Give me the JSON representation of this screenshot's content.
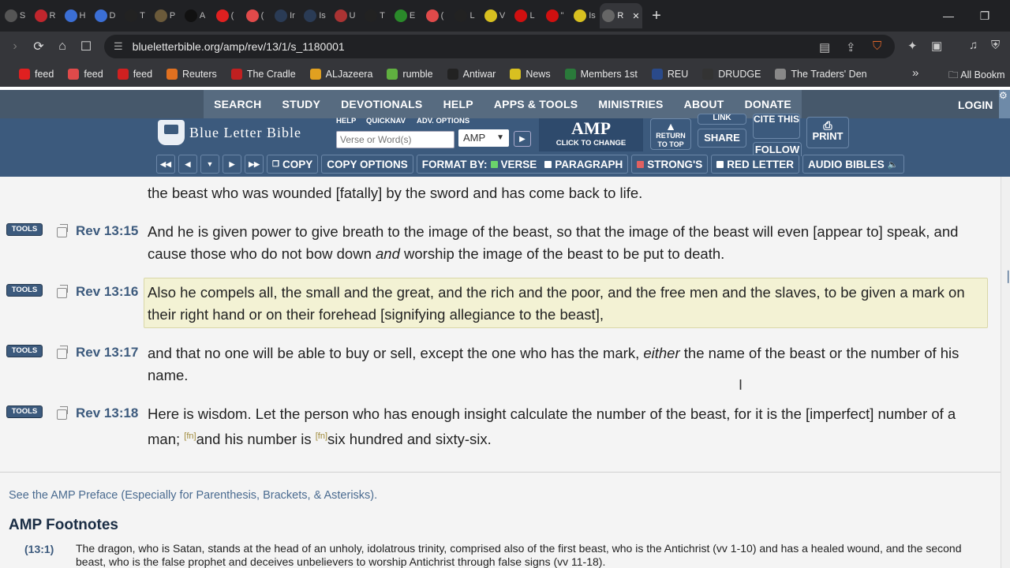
{
  "browser": {
    "tabs": [
      {
        "label": "S",
        "color": "#555"
      },
      {
        "label": "R",
        "color": "#c0262d"
      },
      {
        "label": "H",
        "color": "#3b6fd6"
      },
      {
        "label": "D",
        "color": "#3b6fd6"
      },
      {
        "label": "T",
        "color": "#222"
      },
      {
        "label": "P",
        "color": "#6b5a3a"
      },
      {
        "label": "A",
        "color": "#111"
      },
      {
        "label": "(",
        "color": "#e02020"
      },
      {
        "label": "(",
        "color": "#e04a4a"
      },
      {
        "label": "Ir",
        "color": "#2a3b55"
      },
      {
        "label": "Is",
        "color": "#2a3b55"
      },
      {
        "label": "U",
        "color": "#a33"
      },
      {
        "label": "T",
        "color": "#222"
      },
      {
        "label": "E",
        "color": "#2a8a2a"
      },
      {
        "label": "(",
        "color": "#e04a4a"
      },
      {
        "label": "L",
        "color": "#222"
      },
      {
        "label": "V",
        "color": "#d8c020"
      },
      {
        "label": "L",
        "color": "#d01010"
      },
      {
        "label": "\"",
        "color": "#d01010"
      },
      {
        "label": "Is",
        "color": "#d8c020"
      },
      {
        "label": "R",
        "color": "#666"
      }
    ],
    "active_tab_close": "✕",
    "new_tab": "+",
    "minimize": "—",
    "restore": "❐",
    "close": "✕",
    "url": "blueletterbible.org/amp/rev/13/1/s_1180001",
    "bookmarks": [
      {
        "label": "feed",
        "color": "#e02020"
      },
      {
        "label": "feed",
        "color": "#e04a4a"
      },
      {
        "label": "feed",
        "color": "#d02020"
      },
      {
        "label": "Reuters",
        "color": "#e07020"
      },
      {
        "label": "The Cradle",
        "color": "#c02020"
      },
      {
        "label": "ALJazeera",
        "color": "#e0a020"
      },
      {
        "label": "rumble",
        "color": "#60b040"
      },
      {
        "label": "Antiwar",
        "color": "#222"
      },
      {
        "label": "News",
        "color": "#d8c020"
      },
      {
        "label": "Members 1st",
        "color": "#2a7a3a"
      },
      {
        "label": "REU",
        "color": "#2a4a8a"
      },
      {
        "label": "DRUDGE",
        "color": "#333"
      },
      {
        "label": "The Traders' Den",
        "color": "#888"
      }
    ],
    "all_bookmarks": "All Bookm"
  },
  "site": {
    "nav": [
      "SEARCH",
      "STUDY",
      "DEVOTIONALS",
      "HELP",
      "APPS & TOOLS",
      "MINISTRIES",
      "ABOUT",
      "DONATE"
    ],
    "login": "LOGIN",
    "logo": "Blue Letter Bible",
    "mini_links": [
      "HELP",
      "QUICKNAV",
      "ADV. OPTIONS"
    ],
    "search_placeholder": "Verse or Word(s)",
    "version": "AMP",
    "amp_big": "AMP",
    "amp_small": "CLICK TO CHANGE",
    "return_top": [
      "RETURN",
      "TO TOP"
    ],
    "link": "LINK",
    "share": "SHARE",
    "cite": "CITE THIS",
    "follow": "FOLLOW",
    "print": "PRINT",
    "toolbar": {
      "copy": "COPY",
      "copy_options": "COPY OPTIONS",
      "format_by": "FORMAT BY:",
      "verse": "VERSE",
      "paragraph": "PARAGRAPH",
      "strongs": "STRONG'S",
      "red_letter": "RED LETTER",
      "audio": "AUDIO BIBLES"
    }
  },
  "verses": [
    {
      "ref": "",
      "text": "the beast who was wounded [fatally] by the sword and has come back to life."
    },
    {
      "ref": "Rev 13:15",
      "text_a": "And he is given power to give breath to the image of the beast, so that the image of the beast will even [appear to] speak, and cause those who do not bow down ",
      "em": "and",
      "text_b": " worship the image of the beast to be put to death."
    },
    {
      "ref": "Rev 13:16",
      "text": "Also he compels all, the small and the great, and the rich and the poor, and the free men and the slaves, to be given a mark on their right hand or on their forehead [signifying allegiance to the beast],"
    },
    {
      "ref": "Rev 13:17",
      "text_a": "and that no one will be able to buy or sell, except the one who has the mark, ",
      "em": "either",
      "text_b": " the name of the beast or the number of his name."
    },
    {
      "ref": "Rev 13:18",
      "text_a": "Here is wisdom. Let the person who has enough insight calculate the number of the beast, for it is the [imperfect] number of a man; ",
      "fn1": "[fn]",
      "text_b": "and his number is ",
      "fn2": "[fn]",
      "text_c": "six hundred and sixty-six."
    }
  ],
  "tools_label": "TOOLS",
  "preface": "See the AMP Preface (Especially for Parenthesis, Brackets, & Asterisks).",
  "footnotes_heading": "AMP Footnotes",
  "footnote": {
    "ref": "(13:1)",
    "text": "The dragon, who is Satan, stands at the head of an unholy, idolatrous trinity, comprised also of the first beast, who is the Antichrist (vv 1-10) and has a healed wound, and the second beast, who is the false prophet and deceives unbelievers to worship Antichrist through false signs (vv 11-18)."
  }
}
